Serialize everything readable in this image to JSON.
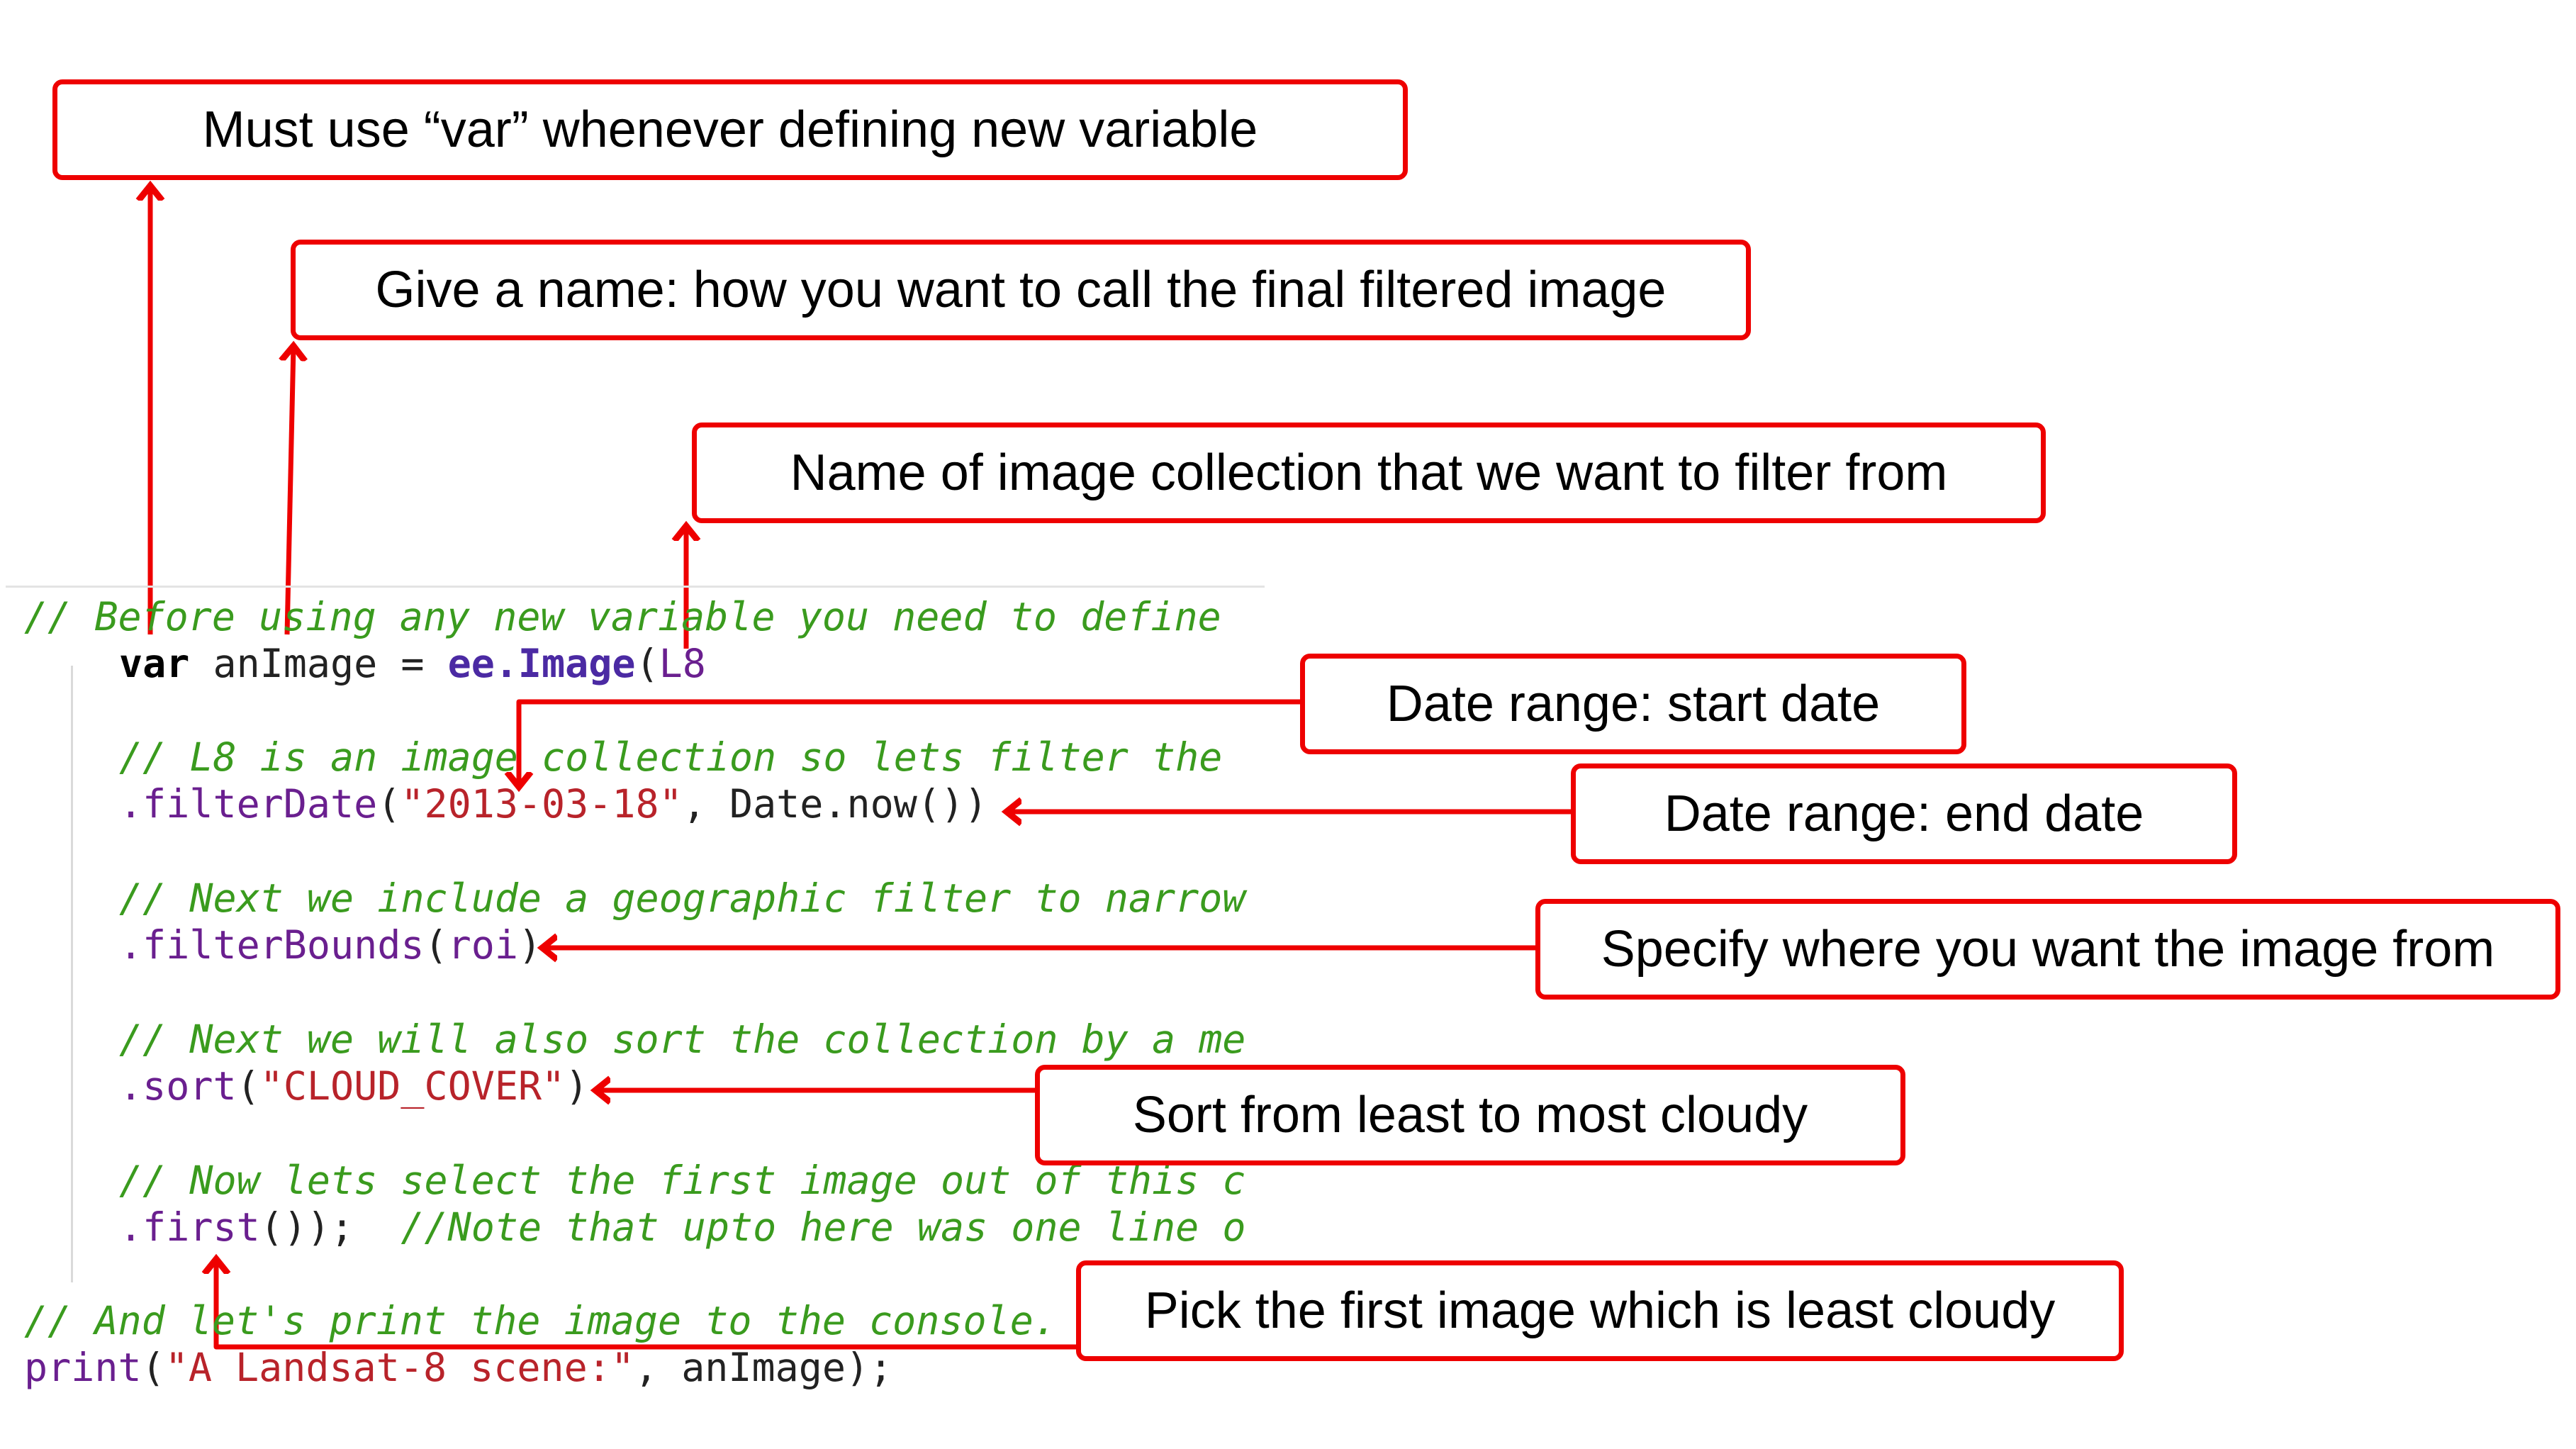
{
  "callouts": {
    "var_keyword": "Must use “var” whenever defining new variable",
    "variable_name": "Give a name: how you want to call the final filtered image",
    "collection_name": "Name of image collection that we want to filter from",
    "start_date": "Date range: start date",
    "end_date": "Date range: end date",
    "bounds": "Specify where you want the image from",
    "sort": "Sort from least to most cloudy",
    "first": "Pick the first image which is least cloudy"
  },
  "code": {
    "comment_define": "// Before using any new variable you need to define",
    "var_kw": "var",
    "var_name": " anImage = ",
    "ee_image": "ee.Image",
    "paren_open": "(",
    "collection": "L8",
    "comment_collection": "// L8 is an image collection so lets filter the",
    "filter_date_fn": ".filterDate",
    "filter_date_open": "(",
    "start_date": "\"2013-03-18\"",
    "filter_date_rest": ", Date.now())",
    "comment_geo": "// Next we include a geographic filter to narrow",
    "filter_bounds_fn": ".filterBounds",
    "filter_bounds_open": "(",
    "roi": "roi",
    "filter_bounds_close": ")",
    "comment_sort": "// Next we will also sort the collection by a me",
    "sort_fn": ".sort",
    "sort_open": "(",
    "cloud_cover": "\"CLOUD_COVER\"",
    "sort_close": ")",
    "comment_first": "// Now lets select the first image out of this c",
    "first_fn": ".first",
    "first_rest": "());  ",
    "first_note": "//Note that upto here was one line o",
    "comment_print": "// And let's print the image to the console.",
    "print_fn": "print",
    "print_open": "(",
    "print_label": "\"A Landsat-8 scene:\"",
    "print_rest": ", anImage);"
  },
  "colors": {
    "callout_border": "#ee0000",
    "arrow": "#ee0000",
    "comment": "#3a9b1e",
    "string": "#b8232a",
    "function": "#6a1f8f",
    "ee_object": "#4b2aa3"
  }
}
